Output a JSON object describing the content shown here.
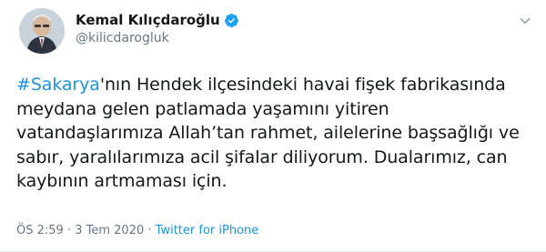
{
  "author": {
    "display_name": "Kemal Kılıçdaroğlu",
    "handle": "@kilicdarogluk",
    "verified": true
  },
  "tweet": {
    "hashtag": "#Sakarya",
    "text": "'nın Hendek ilçesindeki havai fişek fabrikasında meydana gelen patlamada yaşamını yitiren vatandaşlarımıza Allah’tan rahmet, ailelerine başsağlığı ve sabır, yaralılarımıza acil şifalar diliyorum. Dualarımız, can kaybının artmaması için."
  },
  "meta": {
    "time": "ÖS 2:59",
    "separator": "·",
    "date": "3 Tem 2020",
    "separator2": "·",
    "source": "Twitter for iPhone"
  },
  "icons": {
    "verified": "verified-badge-icon",
    "menu": "chevron-down-icon"
  },
  "colors": {
    "link": "#1b95e0",
    "verified": "#1da1f2",
    "secondary_text": "#657786"
  }
}
